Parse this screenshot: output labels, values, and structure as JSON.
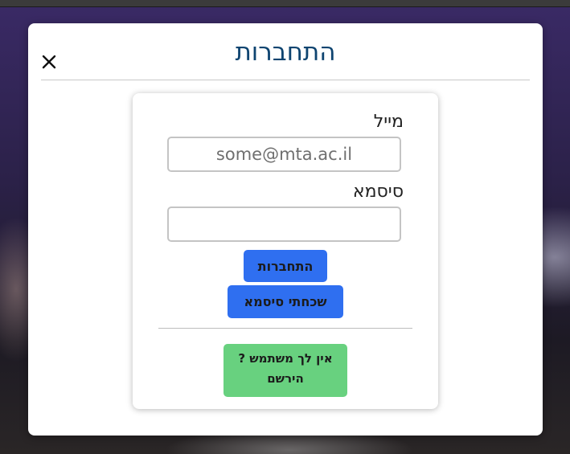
{
  "modal": {
    "title": "התחברות",
    "close_icon": "close-icon"
  },
  "form": {
    "email_label": "מייל",
    "email_placeholder": "some@mta.ac.il",
    "email_value": "",
    "password_label": "סיסמא",
    "password_value": "",
    "login_button": "התחברות",
    "forgot_button": "שכחתי סיסמא",
    "register_prompt": "אין לך משתמש ?",
    "register_link": "הירשם"
  },
  "colors": {
    "title": "#0e4470",
    "primary_button": "#2f6ff0",
    "register_button": "#68d17f"
  }
}
